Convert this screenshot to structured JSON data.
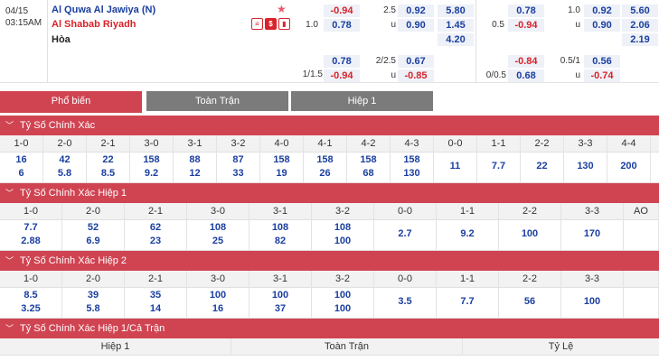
{
  "match": {
    "date": "04/15",
    "time": "03:15AM",
    "home": "Al Quwa Al Jawiya (N)",
    "away": "Al Shabab Riyadh",
    "draw": "Hòa",
    "icons": [
      "list-icon",
      "dollar-icon",
      "chart-icon"
    ],
    "ft": {
      "hdp_away_line": "1.0",
      "hdp_home": "-0.94",
      "hdp_away": "0.78",
      "ou_line": "2.5",
      "ou_u": "u",
      "ou_over": "0.92",
      "ou_under": "0.90",
      "x1": "5.80",
      "x2": "1.45",
      "xx": "4.20",
      "hdp2_line": "1/1.5",
      "hdp2_home": "0.78",
      "hdp2_away": "-0.94",
      "ou2_line": "2/2.5",
      "ou2_u": "u",
      "ou2_over": "0.67",
      "ou2_under": "-0.85"
    },
    "h1": {
      "hdp_away_line": "0.5",
      "hdp_home": "0.78",
      "hdp_away": "-0.94",
      "ou_line": "1.0",
      "ou_u": "u",
      "ou_over": "0.92",
      "ou_under": "0.90",
      "x1": "5.60",
      "x2": "2.06",
      "xx": "2.19",
      "hdp2_line": "0/0.5",
      "hdp2_home": "-0.84",
      "hdp2_away": "0.68",
      "ou2_line": "0.5/1",
      "ou2_u": "u",
      "ou2_over": "0.56",
      "ou2_under": "-0.74"
    }
  },
  "tabs": [
    "Phổ biến",
    "Toàn Trận",
    "Hiệp 1"
  ],
  "sections": {
    "s1": {
      "title": "Tỷ Số Chính Xác",
      "cols": [
        {
          "score": "1-0",
          "a": "16",
          "b": "6"
        },
        {
          "score": "2-0",
          "a": "42",
          "b": "5.8"
        },
        {
          "score": "2-1",
          "a": "22",
          "b": "8.5"
        },
        {
          "score": "3-0",
          "a": "158",
          "b": "9.2"
        },
        {
          "score": "3-1",
          "a": "88",
          "b": "12"
        },
        {
          "score": "3-2",
          "a": "87",
          "b": "33"
        },
        {
          "score": "4-0",
          "a": "158",
          "b": "19"
        },
        {
          "score": "4-1",
          "a": "158",
          "b": "26"
        },
        {
          "score": "4-2",
          "a": "158",
          "b": "68"
        },
        {
          "score": "4-3",
          "a": "158",
          "b": "130"
        },
        {
          "score": "0-0",
          "m": "11"
        },
        {
          "score": "1-1",
          "m": "7.7"
        },
        {
          "score": "2-2",
          "m": "22"
        },
        {
          "score": "3-3",
          "m": "130"
        },
        {
          "score": "4-4",
          "m": "200"
        }
      ]
    },
    "s2": {
      "title": "Tỷ Số Chính Xác Hiệp 1",
      "cols": [
        {
          "score": "1-0",
          "a": "7.7",
          "b": "2.88"
        },
        {
          "score": "2-0",
          "a": "52",
          "b": "6.9"
        },
        {
          "score": "2-1",
          "a": "62",
          "b": "23"
        },
        {
          "score": "3-0",
          "a": "108",
          "b": "25"
        },
        {
          "score": "3-1",
          "a": "108",
          "b": "82"
        },
        {
          "score": "3-2",
          "a": "108",
          "b": "100"
        },
        {
          "score": "0-0",
          "m": "2.7"
        },
        {
          "score": "1-1",
          "m": "9.2"
        },
        {
          "score": "2-2",
          "m": "100"
        },
        {
          "score": "3-3",
          "m": "170"
        },
        {
          "score": "AO",
          "m": ""
        }
      ]
    },
    "s3": {
      "title": "Tỷ Số Chính Xác Hiệp 2",
      "cols": [
        {
          "score": "1-0",
          "a": "8.5",
          "b": "3.25"
        },
        {
          "score": "2-0",
          "a": "39",
          "b": "5.8"
        },
        {
          "score": "2-1",
          "a": "35",
          "b": "14"
        },
        {
          "score": "3-0",
          "a": "100",
          "b": "16"
        },
        {
          "score": "3-1",
          "a": "100",
          "b": "37"
        },
        {
          "score": "3-2",
          "a": "100",
          "b": "100"
        },
        {
          "score": "0-0",
          "m": "3.5"
        },
        {
          "score": "1-1",
          "m": "7.7"
        },
        {
          "score": "2-2",
          "m": "56"
        },
        {
          "score": "3-3",
          "m": "100"
        },
        {
          "score": "",
          "m": ""
        }
      ]
    },
    "s4": {
      "title": "Tỷ Số Chính Xác Hiệp 1/Cả Trận",
      "cols": [
        "Hiệp 1",
        "Toàn Trận",
        "Tỷ Lệ"
      ]
    }
  }
}
